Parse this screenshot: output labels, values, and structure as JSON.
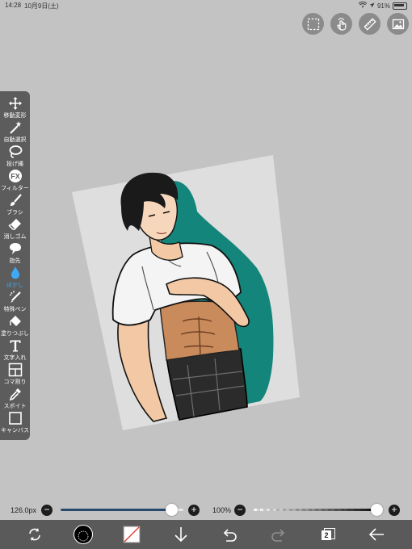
{
  "status_bar": {
    "time": "14:28",
    "date": "10月9日(土)",
    "battery": "91%"
  },
  "top_tools": [
    "selection-icon",
    "hand-gesture-icon",
    "ruler-icon",
    "material-icon"
  ],
  "toolbar": {
    "items": [
      {
        "label": "移動変形",
        "icon": "move-icon"
      },
      {
        "label": "自動選択",
        "icon": "magic-wand-icon"
      },
      {
        "label": "投げ縄",
        "icon": "lasso-icon"
      },
      {
        "label": "フィルター",
        "icon": "fx-icon"
      },
      {
        "label": "ブラシ",
        "icon": "brush-icon"
      },
      {
        "label": "消しゴム",
        "icon": "eraser-icon"
      },
      {
        "label": "指先",
        "icon": "finger-icon"
      },
      {
        "label": "ぼかし",
        "icon": "blur-drop-icon",
        "active": true
      },
      {
        "label": "特殊ペン",
        "icon": "special-pen-icon"
      },
      {
        "label": "塗りつぶし",
        "icon": "bucket-icon"
      },
      {
        "label": "文字入れ",
        "icon": "text-icon"
      },
      {
        "label": "コマ割り",
        "icon": "frame-divide-icon"
      },
      {
        "label": "スポイト",
        "icon": "eyedropper-icon"
      },
      {
        "label": "キャンバス",
        "icon": "canvas-icon"
      }
    ],
    "active_color": "#3fa9f5"
  },
  "brush_size": {
    "label": "126.0px",
    "level": 0.9,
    "accent": "#27496d"
  },
  "opacity": {
    "label": "100%",
    "level": 1.0
  },
  "bottom_bar": {
    "items": [
      "transform-icon",
      "brush-preview-icon",
      "color-swatch-icon",
      "download-arrow-icon",
      "undo-icon",
      "redo-icon",
      "layers-icon",
      "back-arrow-icon"
    ],
    "layer_count": "2"
  },
  "canvas": {
    "paper_color": "#dedede",
    "shadow_color": "#14857a",
    "skin_color": "#f2c9a4"
  }
}
